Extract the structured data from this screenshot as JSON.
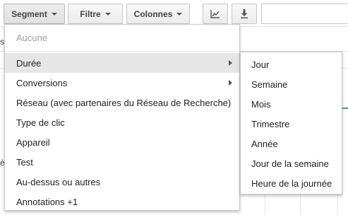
{
  "toolbar": {
    "segment_label": "Segment",
    "filter_label": "Filtre",
    "columns_label": "Colonnes",
    "chart_icon": "chart-line-icon",
    "download_icon": "download-icon",
    "search_value": ""
  },
  "background": {
    "frag_s": "s",
    "frag_e": "è"
  },
  "segment_menu": {
    "items": [
      {
        "label": "Aucune",
        "disabled": true
      },
      {
        "label": "Durée",
        "submenu": true,
        "highlighted": true
      },
      {
        "label": "Conversions",
        "submenu": true
      },
      {
        "label": "Réseau (avec partenaires du Réseau de Recherche)"
      },
      {
        "label": "Type de clic"
      },
      {
        "label": "Appareil"
      },
      {
        "label": "Test"
      },
      {
        "label": "Au-dessus ou autres"
      },
      {
        "label": "Annotations +1"
      }
    ]
  },
  "duration_submenu": {
    "items": [
      {
        "label": "Jour"
      },
      {
        "label": "Semaine"
      },
      {
        "label": "Mois"
      },
      {
        "label": "Trimestre"
      },
      {
        "label": "Année"
      },
      {
        "label": "Jour de la semaine"
      },
      {
        "label": "Heure de la journée"
      }
    ]
  }
}
